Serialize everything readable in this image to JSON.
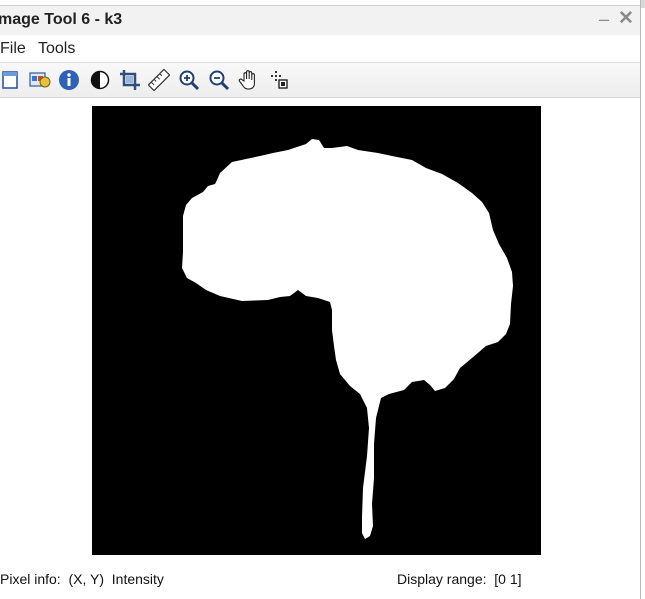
{
  "window": {
    "title": "mage Tool 6 - k3",
    "minimize_glyph": "–",
    "close_glyph": "✕"
  },
  "menu": {
    "items": [
      "File",
      "Tools"
    ]
  },
  "toolbar": {
    "tools": [
      {
        "icon": "new-window-icon"
      },
      {
        "icon": "image-info-icon"
      },
      {
        "icon": "info-icon"
      },
      {
        "icon": "contrast-icon"
      },
      {
        "icon": "crop-icon"
      },
      {
        "icon": "ruler-icon"
      },
      {
        "icon": "zoom-in-icon"
      },
      {
        "icon": "zoom-out-icon"
      },
      {
        "icon": "pan-hand-icon"
      },
      {
        "icon": "pixel-region-icon"
      }
    ]
  },
  "image": {
    "description_colors": {
      "background": "#000000",
      "foreground": "#ffffff"
    }
  },
  "status": {
    "pixel_info": "Pixel info:  (X, Y)  Intensity",
    "display_range": "Display range:  [0 1]"
  }
}
